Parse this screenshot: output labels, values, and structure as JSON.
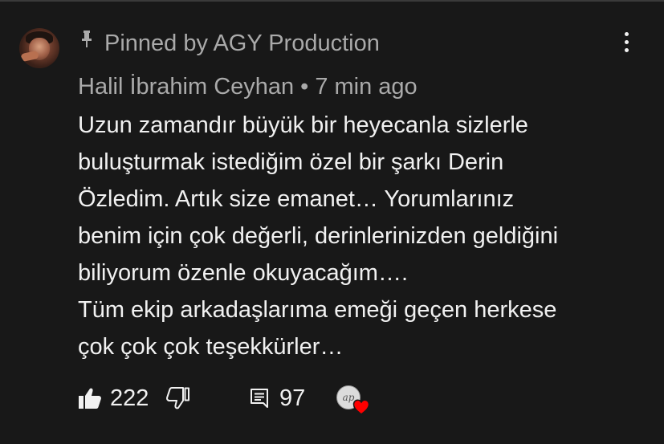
{
  "comment": {
    "pinned_text": "Pinned by AGY Production",
    "author": "Halil İbrahim Ceyhan",
    "separator": "•",
    "timestamp": "7 min ago",
    "body_lines": [
      "Uzun zamandır büyük bir heyecanla sizlerle",
      "buluşturmak istediğim özel bir şarkı Derin",
      "Özledim. Artık size emanet… Yorumlarınız",
      "benim için çok değerli, derinlerinizden geldiğini",
      "biliyorum özenle okuyacağım….",
      "Tüm ekip arkadaşlarıma emeği geçen herkese",
      "çok çok çok teşekkürler…"
    ]
  },
  "actions": {
    "like_count": "222",
    "reply_count": "97"
  },
  "creator_heart": {
    "avatar_text": "ap"
  },
  "icons": {
    "pin": "pin-icon",
    "menu": "more-vert-icon",
    "like": "thumb-up-filled-icon",
    "dislike": "thumb-down-outline-icon",
    "reply": "comment-icon",
    "heart": "heart-icon"
  },
  "colors": {
    "background": "#181818",
    "primary_text": "#f1f1f1",
    "secondary_text": "#aaaaaa",
    "heart_red": "#ff0000"
  }
}
